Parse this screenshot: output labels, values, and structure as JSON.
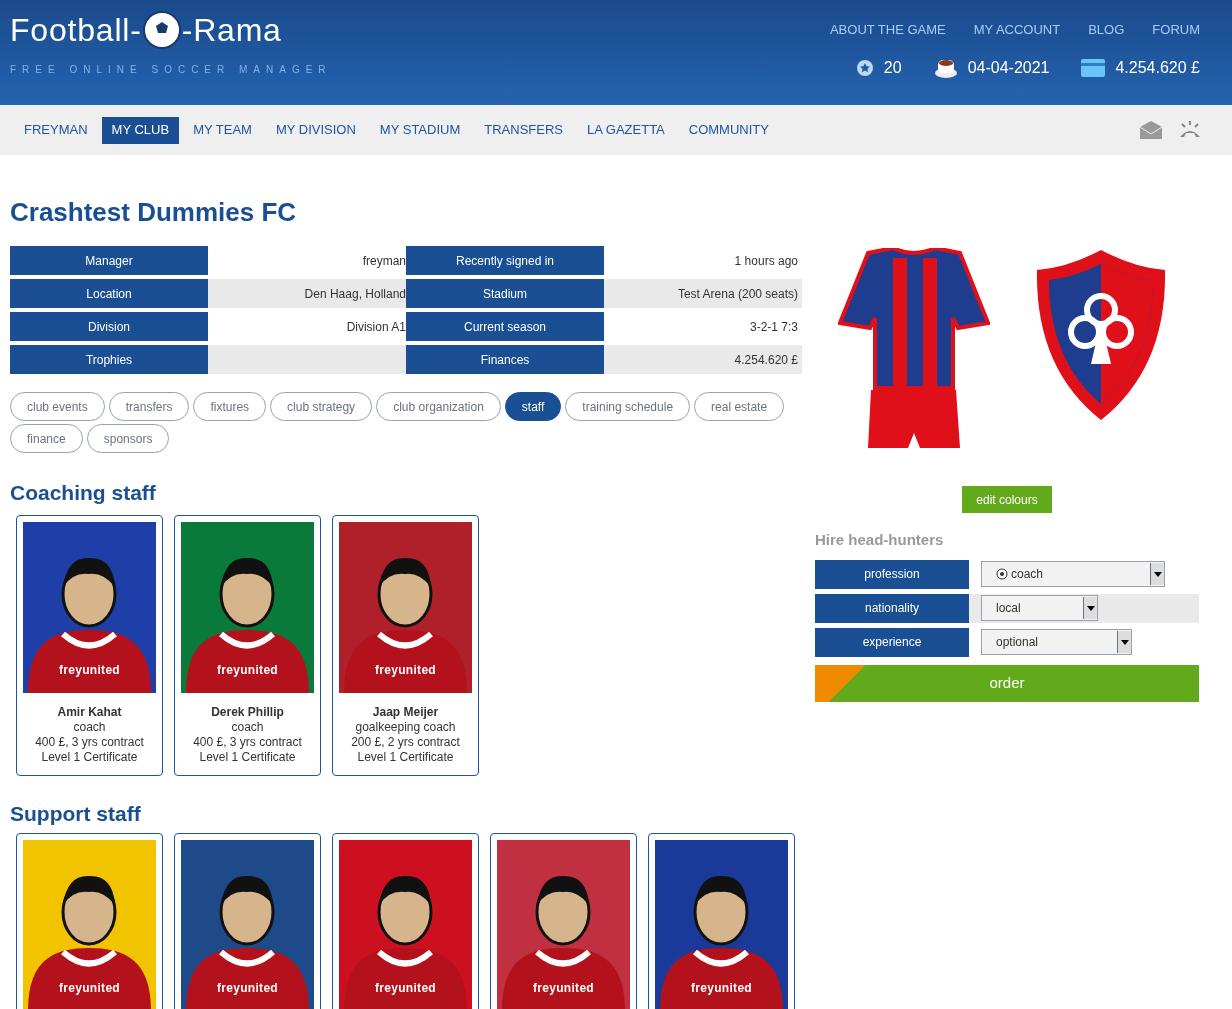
{
  "header": {
    "logo": "Football-",
    "logo_end": "-Rama",
    "tagline": "FREE ONLINE SOCCER MANAGER",
    "links": [
      "ABOUT THE GAME",
      "MY ACCOUNT",
      "BLOG",
      "FORUM"
    ],
    "stats": [
      {
        "kind": "stars",
        "value": "20"
      },
      {
        "kind": "date",
        "value": "04-04-2021"
      },
      {
        "kind": "money",
        "value": "4.254.620 £"
      }
    ]
  },
  "nav": [
    {
      "label": "FREYMAN",
      "selected": false
    },
    {
      "label": "MY CLUB",
      "selected": true
    },
    {
      "label": "MY TEAM",
      "selected": false
    },
    {
      "label": "MY DIVISION",
      "selected": false
    },
    {
      "label": "MY STADIUM",
      "selected": false
    },
    {
      "label": "TRANSFERS",
      "selected": false
    },
    {
      "label": "LA GAZETTA",
      "selected": false
    },
    {
      "label": "COMMUNITY",
      "selected": false
    }
  ],
  "club": {
    "title": "Crashtest Dummies FC",
    "info": [
      {
        "label": "Manager",
        "value": "freyman",
        "label2": "Recently signed in",
        "value2": "1 hours ago"
      },
      {
        "label": "Location",
        "value": "Den Haag, Holland",
        "label2": "Stadium",
        "value2": "Test Arena (200 seats)"
      },
      {
        "label": "Division",
        "value": "Division A1",
        "label2": "Current season",
        "value2": "3-2-1 7:3"
      },
      {
        "label": "Trophies",
        "label2": "Finances",
        "value2": "4.254.620 £"
      }
    ]
  },
  "tabs": [
    {
      "label": "club events",
      "selected": false
    },
    {
      "label": "transfers",
      "selected": false
    },
    {
      "label": "fixtures",
      "selected": false
    },
    {
      "label": "club strategy",
      "selected": false
    },
    {
      "label": "club organization",
      "selected": false
    },
    {
      "label": "staff",
      "selected": true
    },
    {
      "label": "training schedule",
      "selected": false
    },
    {
      "label": "real estate",
      "selected": false
    },
    {
      "label": "finance",
      "selected": false
    },
    {
      "label": "sponsors",
      "selected": false
    }
  ],
  "coaching": {
    "title": "Coaching staff",
    "staff": [
      {
        "shirt": "freyunited",
        "color": "#1f3fa8",
        "name": "Amir Kahat",
        "role": "coach",
        "contract": "400 £, 3 yrs contract",
        "cert": "Level 1 Certificate"
      },
      {
        "shirt": "freyunited",
        "color": "#0a7a3a",
        "name": "Derek Phillip",
        "role": "coach",
        "contract": "400 £, 3 yrs contract",
        "cert": "Level 1 Certificate"
      },
      {
        "shirt": "freyunited",
        "color": "#b0202a",
        "name": "Jaap Meijer",
        "role": "goalkeeping coach",
        "contract": "200 £, 2 yrs contract",
        "cert": "Level 1 Certificate"
      }
    ]
  },
  "support": {
    "title": "Support staff",
    "staff": [
      {
        "shirt": "freyunited",
        "color": "#f2c400"
      },
      {
        "shirt": "freyunited",
        "color": "#1e4a8a"
      },
      {
        "shirt": "freyunited",
        "color": "#cc1020"
      },
      {
        "shirt": "freyunited",
        "color": "#c03040"
      },
      {
        "shirt": "freyunited",
        "color": "#1a3a9a"
      }
    ]
  },
  "edit_button": "edit colours",
  "hire": {
    "title": "Hire head-hunters",
    "fields": [
      {
        "label": "profession",
        "value": "coach",
        "kind": "ball"
      },
      {
        "label": "nationality",
        "value": "local",
        "kind": "plain"
      },
      {
        "label": "experience",
        "value": "optional",
        "kind": "plain"
      }
    ],
    "order": "order"
  }
}
